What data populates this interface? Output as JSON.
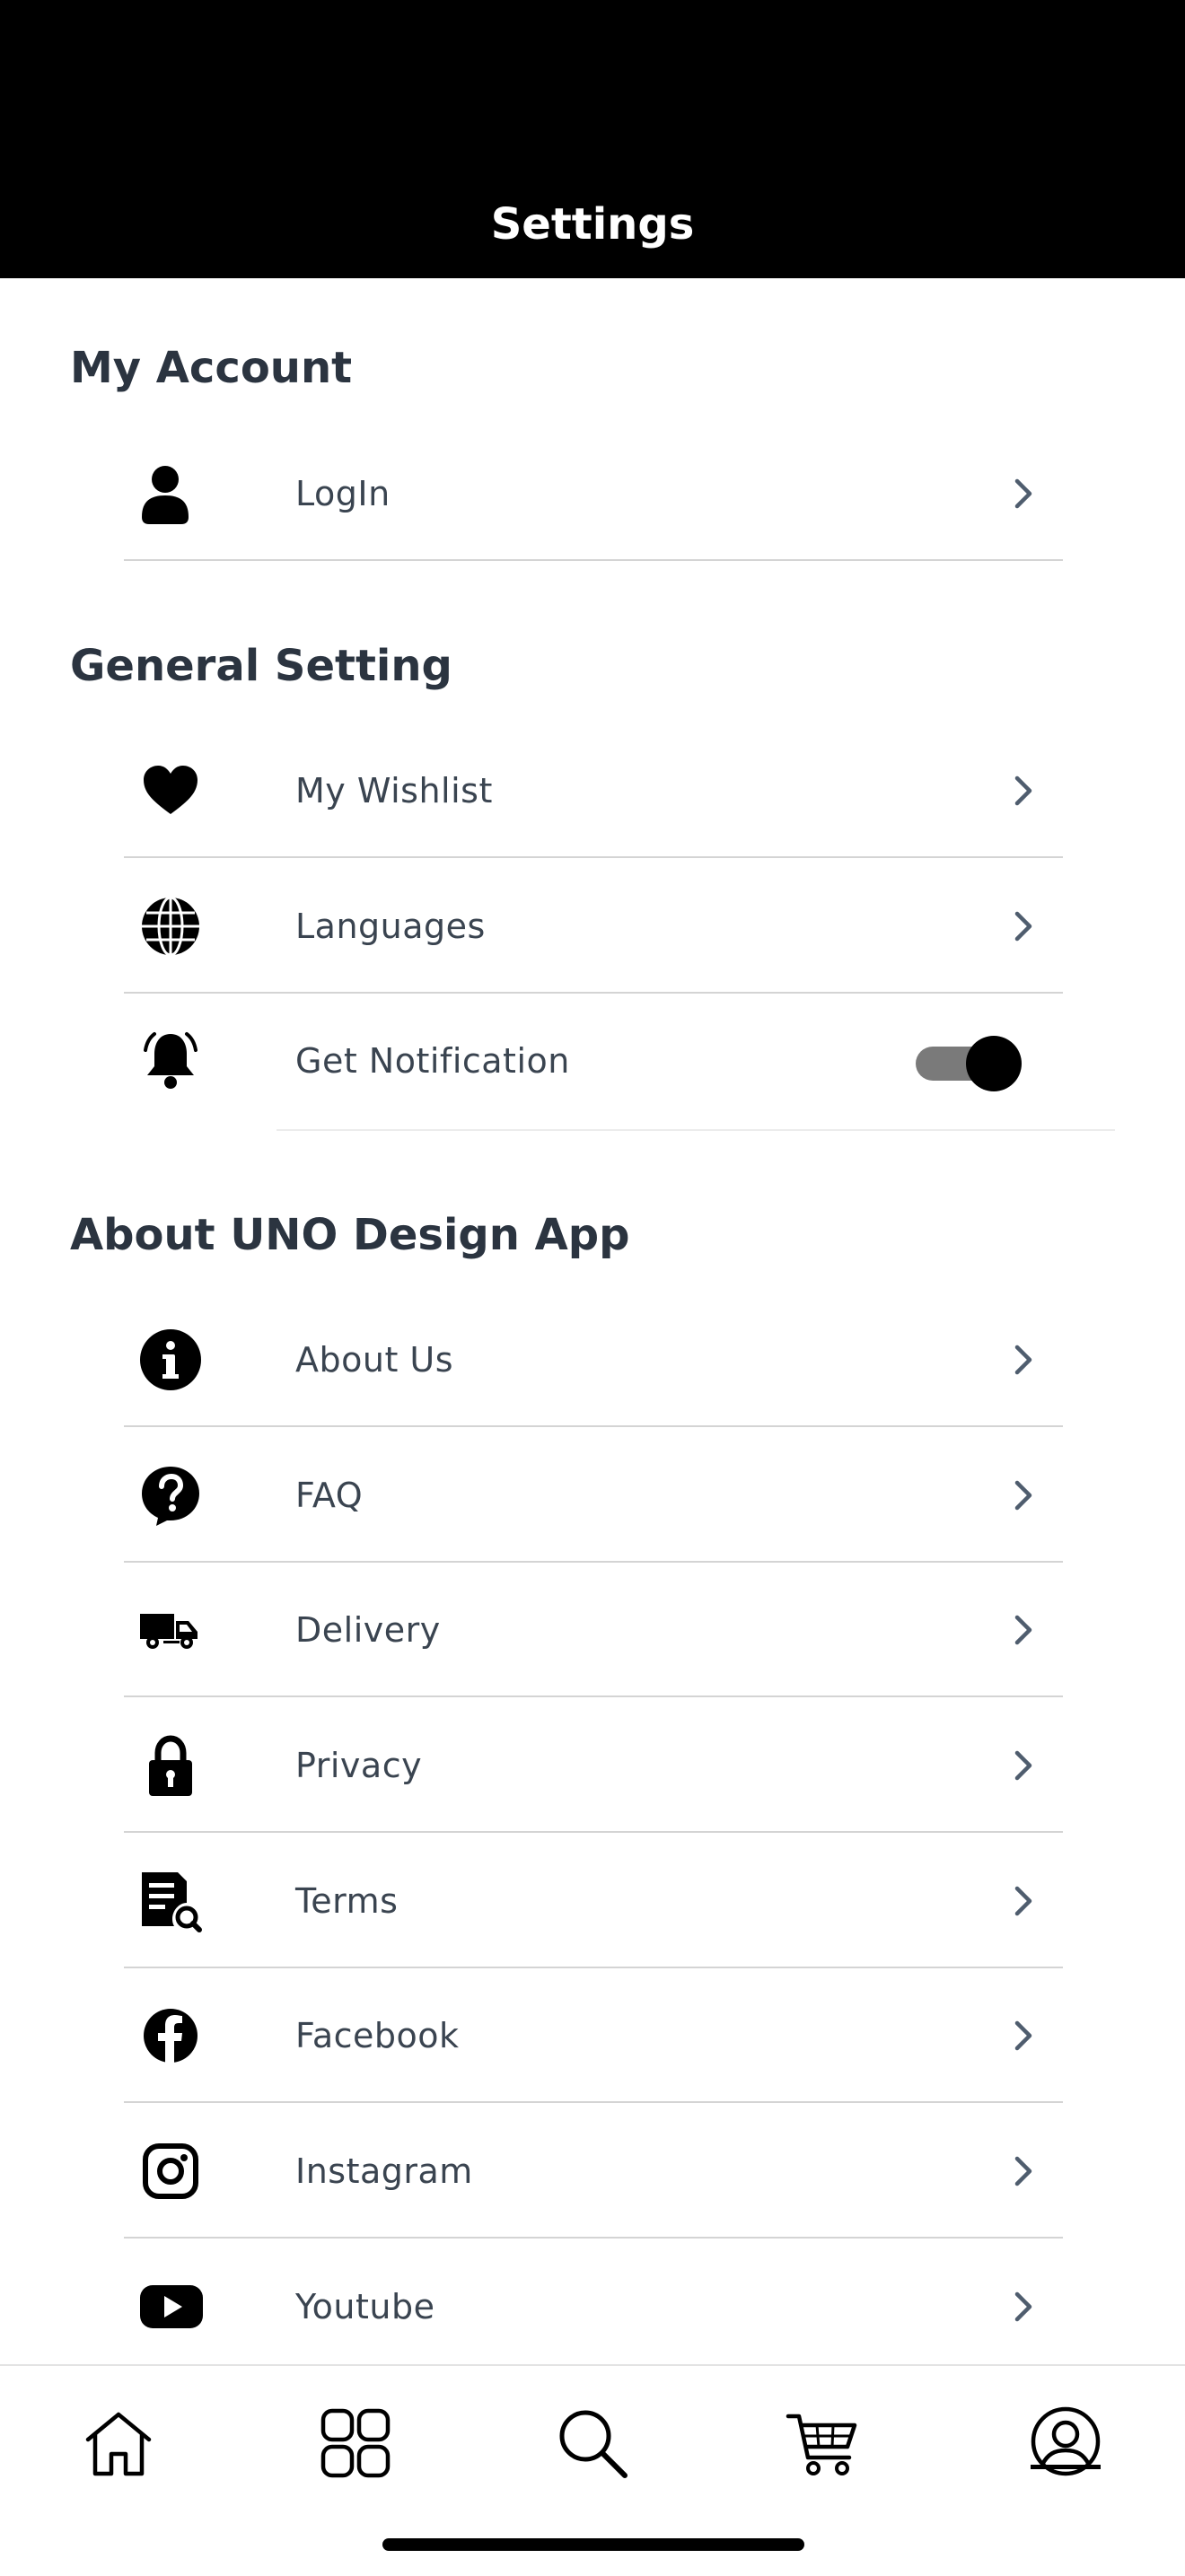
{
  "header": {
    "title": "Settings"
  },
  "sections": {
    "account": {
      "title": "My Account",
      "items": [
        {
          "label": "LogIn",
          "icon": "user-icon"
        }
      ]
    },
    "general": {
      "title": "General Setting",
      "items": [
        {
          "label": "My Wishlist",
          "icon": "heart-icon"
        },
        {
          "label": "Languages",
          "icon": "globe-icon"
        },
        {
          "label": "Get Notification",
          "icon": "bell-icon",
          "toggle_on": true
        }
      ]
    },
    "about": {
      "title": "About UNO Design App",
      "items": [
        {
          "label": "About Us",
          "icon": "info-icon"
        },
        {
          "label": "FAQ",
          "icon": "question-icon"
        },
        {
          "label": "Delivery",
          "icon": "truck-icon"
        },
        {
          "label": "Privacy",
          "icon": "lock-icon"
        },
        {
          "label": "Terms",
          "icon": "document-search-icon"
        },
        {
          "label": "Facebook",
          "icon": "facebook-icon"
        },
        {
          "label": "Instagram",
          "icon": "instagram-icon"
        },
        {
          "label": "Youtube",
          "icon": "youtube-icon"
        }
      ]
    }
  },
  "tabbar": {
    "tabs": [
      {
        "icon": "home-icon"
      },
      {
        "icon": "categories-icon"
      },
      {
        "icon": "search-icon"
      },
      {
        "icon": "cart-icon"
      },
      {
        "icon": "profile-icon",
        "active": true
      }
    ]
  },
  "colors": {
    "header_bg": "#000000",
    "text": "#2b3440",
    "chevron": "#4f5d6e",
    "toggle_track": "#7a7a7a"
  }
}
